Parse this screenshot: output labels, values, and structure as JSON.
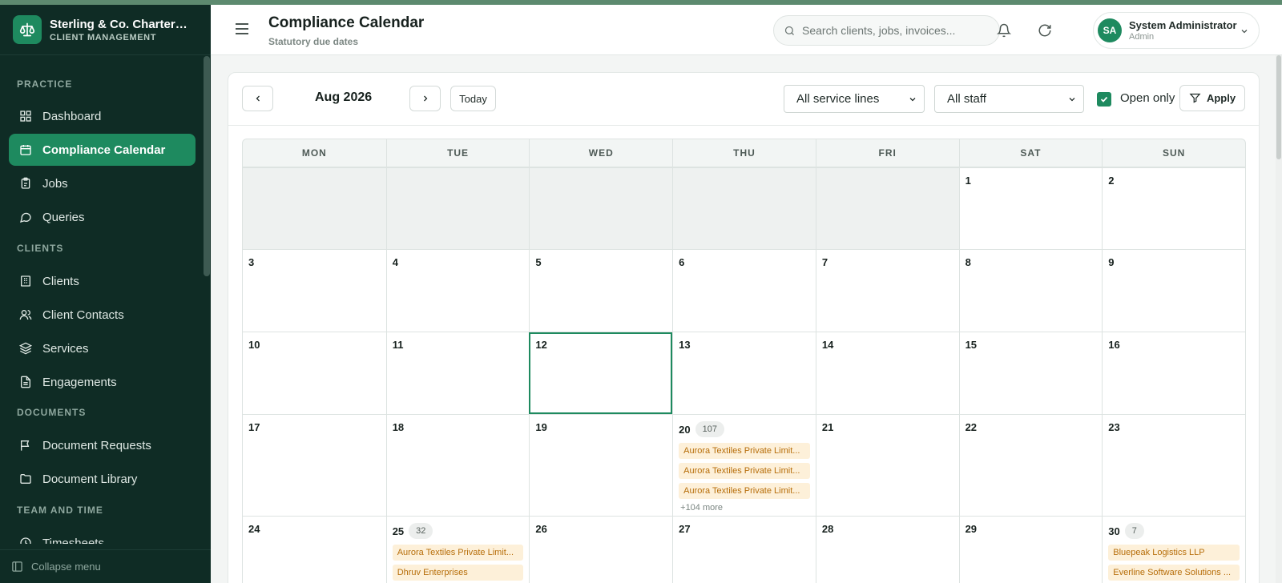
{
  "app": {
    "brand_name": "Sterling & Co. Chartered ...",
    "brand_sub": "CLIENT MANAGEMENT"
  },
  "sidebar": {
    "sections": [
      {
        "label": "PRACTICE"
      },
      {
        "label": "CLIENTS"
      },
      {
        "label": "DOCUMENTS"
      },
      {
        "label": "TEAM AND TIME"
      }
    ],
    "items": [
      {
        "label": "Dashboard",
        "icon": "grid-icon"
      },
      {
        "label": "Compliance Calendar",
        "icon": "calendar-icon",
        "active": true
      },
      {
        "label": "Jobs",
        "icon": "clipboard-icon"
      },
      {
        "label": "Queries",
        "icon": "chat-icon"
      },
      {
        "label": "Clients",
        "icon": "building-icon"
      },
      {
        "label": "Client Contacts",
        "icon": "users-icon"
      },
      {
        "label": "Services",
        "icon": "layers-icon"
      },
      {
        "label": "Engagements",
        "icon": "file-text-icon"
      },
      {
        "label": "Document Requests",
        "icon": "flag-icon"
      },
      {
        "label": "Document Library",
        "icon": "folder-icon"
      },
      {
        "label": "Timesheets",
        "icon": "clock-icon"
      }
    ],
    "collapse_label": "Collapse menu"
  },
  "header": {
    "title": "Compliance Calendar",
    "subtitle": "Statutory due dates",
    "search_placeholder": "Search clients, jobs, invoices...",
    "user": {
      "initials": "SA",
      "name": "System Administrator",
      "role": "Admin"
    }
  },
  "toolbar": {
    "month_label": "Aug 2026",
    "today_label": "Today",
    "service_filter": "All service lines",
    "staff_filter": "All staff",
    "open_only_label": "Open only",
    "open_only_checked": true,
    "apply_label": "Apply"
  },
  "calendar": {
    "weekdays": [
      "MON",
      "TUE",
      "WED",
      "THU",
      "FRI",
      "SAT",
      "SUN"
    ],
    "selected_day": "12",
    "weeks": [
      [
        {
          "day": ""
        },
        {
          "day": ""
        },
        {
          "day": ""
        },
        {
          "day": ""
        },
        {
          "day": ""
        },
        {
          "day": "1"
        },
        {
          "day": "2"
        }
      ],
      [
        {
          "day": "3"
        },
        {
          "day": "4"
        },
        {
          "day": "5"
        },
        {
          "day": "6"
        },
        {
          "day": "7"
        },
        {
          "day": "8"
        },
        {
          "day": "9"
        }
      ],
      [
        {
          "day": "10"
        },
        {
          "day": "11"
        },
        {
          "day": "12"
        },
        {
          "day": "13"
        },
        {
          "day": "14"
        },
        {
          "day": "15"
        },
        {
          "day": "16"
        }
      ],
      [
        {
          "day": "17"
        },
        {
          "day": "18"
        },
        {
          "day": "19"
        },
        {
          "day": "20",
          "count": "107",
          "events": [
            "Aurora Textiles Private Limit...",
            "Aurora Textiles Private Limit...",
            "Aurora Textiles Private Limit..."
          ],
          "more": "+104 more"
        },
        {
          "day": "21"
        },
        {
          "day": "22"
        },
        {
          "day": "23"
        }
      ],
      [
        {
          "day": "24"
        },
        {
          "day": "25",
          "count": "32",
          "events": [
            "Aurora Textiles Private Limit...",
            "Dhruv Enterprises"
          ]
        },
        {
          "day": "26"
        },
        {
          "day": "27"
        },
        {
          "day": "28"
        },
        {
          "day": "29"
        },
        {
          "day": "30",
          "count": "7",
          "events": [
            "Bluepeak Logistics LLP",
            "Everline Software Solutions ..."
          ]
        }
      ]
    ]
  },
  "colors": {
    "sidebar_bg": "#0f2c25",
    "accent": "#1e8a5f",
    "event_bg": "#fdf0d9",
    "event_text": "#b76e0a"
  }
}
